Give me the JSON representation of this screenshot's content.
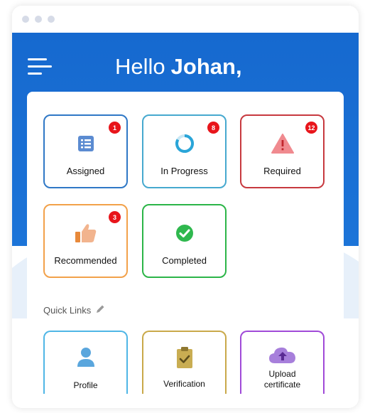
{
  "header": {
    "greeting_prefix": "Hello",
    "user_name": "Johan,"
  },
  "tiles": [
    {
      "label": "Assigned",
      "badge": "1",
      "color": "#2f78c6",
      "icon": "list-icon"
    },
    {
      "label": "In Progress",
      "badge": "8",
      "color": "#46a9cf",
      "icon": "progress-ring-icon"
    },
    {
      "label": "Required",
      "badge": "12",
      "color": "#c7393f",
      "icon": "warning-icon"
    },
    {
      "label": "Recommended",
      "badge": "3",
      "color": "#f2a14a",
      "icon": "thumbs-up-icon"
    },
    {
      "label": "Completed",
      "color": "#2cb548",
      "icon": "check-circle-icon"
    }
  ],
  "quick_links": {
    "title": "Quick Links",
    "items": [
      {
        "label": "Profile",
        "color": "#4fb6e6",
        "icon": "user-icon"
      },
      {
        "label": "Verification",
        "color": "#c9a94a",
        "icon": "clipboard-check-icon"
      },
      {
        "label_line1": "Upload",
        "label_line2": "certificate",
        "color": "#a04ad8",
        "icon": "cloud-upload-icon"
      }
    ]
  },
  "colors": {
    "header_blue": "#1669cf",
    "badge_red": "#e8151b"
  }
}
